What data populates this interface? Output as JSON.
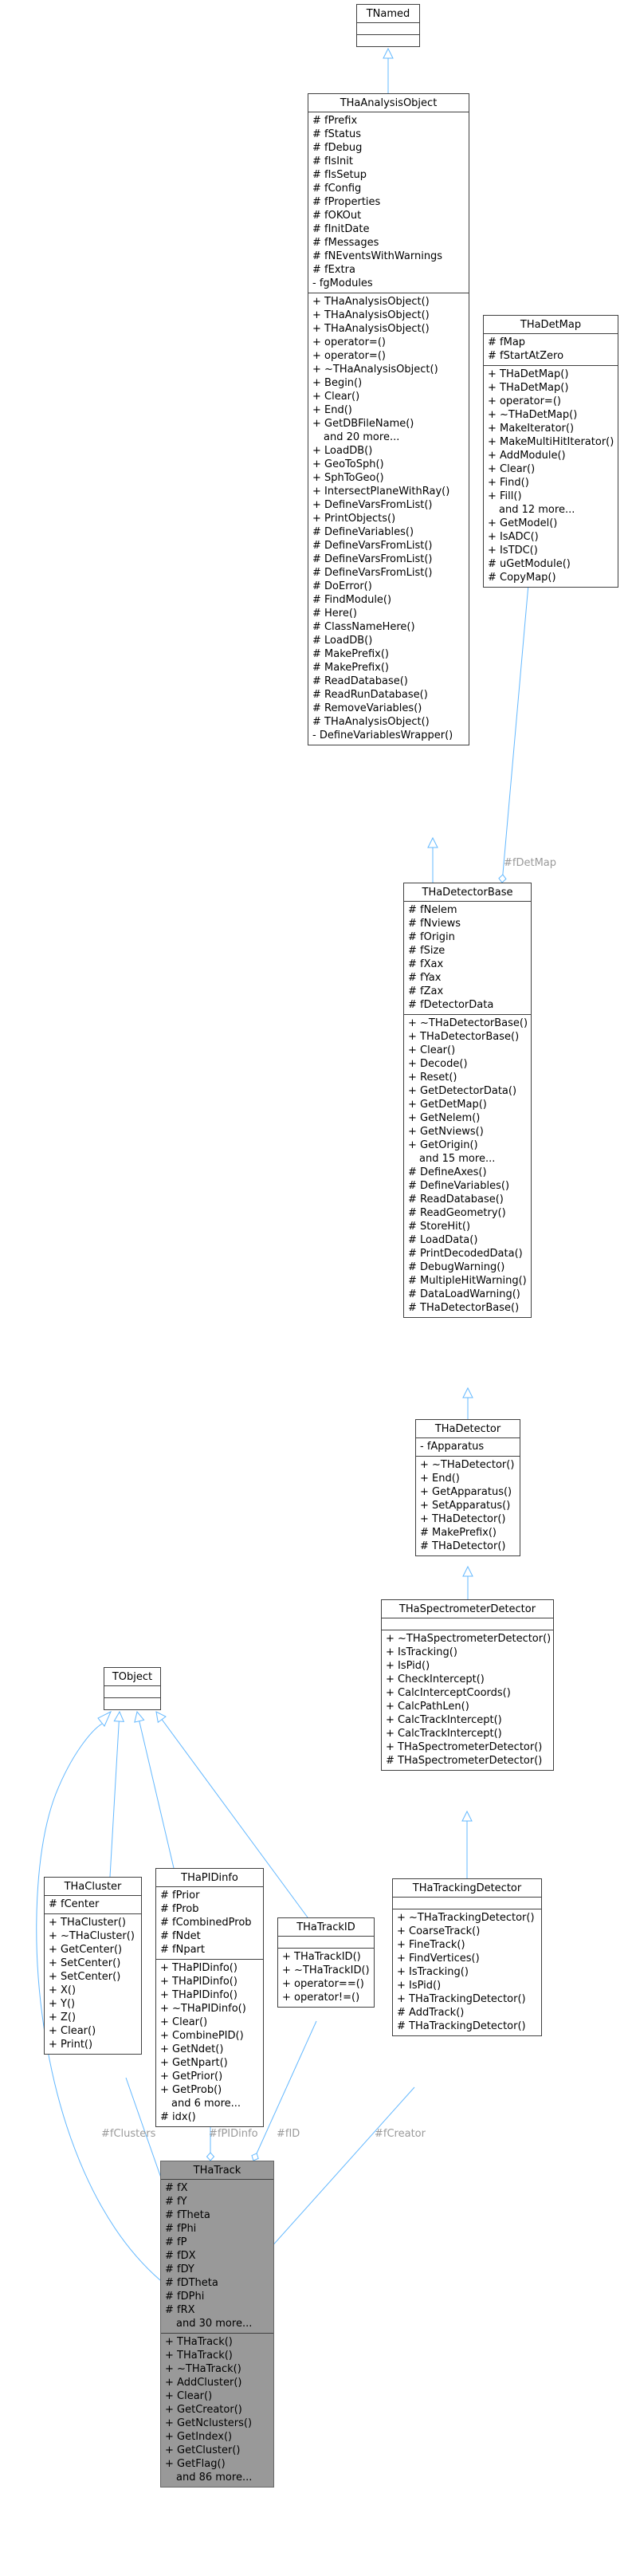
{
  "classes": {
    "TNamed": {
      "name": "TNamed",
      "attrs": [],
      "methods": []
    },
    "THaAnalysisObject": {
      "name": "THaAnalysisObject",
      "attrs": [
        "# fPrefix",
        "# fStatus",
        "# fDebug",
        "# fIsInit",
        "# fIsSetup",
        "# fConfig",
        "# fProperties",
        "# fOKOut",
        "# fInitDate",
        "# fMessages",
        "# fNEventsWithWarnings",
        "# fExtra",
        "- fgModules"
      ],
      "methods": [
        "+ THaAnalysisObject()",
        "+ THaAnalysisObject()",
        "+ THaAnalysisObject()",
        "+ operator=()",
        "+ operator=()",
        "+ ~THaAnalysisObject()",
        "+ Begin()",
        "+ Clear()",
        "+ End()",
        "+ GetDBFileName()",
        "and 20 more...",
        "+ LoadDB()",
        "+ GeoToSph()",
        "+ SphToGeo()",
        "+ IntersectPlaneWithRay()",
        "+ DefineVarsFromList()",
        "+ PrintObjects()",
        "# DefineVariables()",
        "# DefineVarsFromList()",
        "# DefineVarsFromList()",
        "# DefineVarsFromList()",
        "# DoError()",
        "# FindModule()",
        "# Here()",
        "# ClassNameHere()",
        "# LoadDB()",
        "# MakePrefix()",
        "# MakePrefix()",
        "# ReadDatabase()",
        "# ReadRunDatabase()",
        "# RemoveVariables()",
        "# THaAnalysisObject()",
        "- DefineVariablesWrapper()"
      ]
    },
    "THaDetMap": {
      "name": "THaDetMap",
      "attrs": [
        "# fMap",
        "# fStartAtZero"
      ],
      "methods": [
        "+ THaDetMap()",
        "+ THaDetMap()",
        "+ operator=()",
        "+ ~THaDetMap()",
        "+ MakeIterator()",
        "+ MakeMultiHitIterator()",
        "+ AddModule()",
        "+ Clear()",
        "+ Find()",
        "+ Fill()",
        "and 12 more...",
        "+ GetModel()",
        "+ IsADC()",
        "+ IsTDC()",
        "# uGetModule()",
        "# CopyMap()"
      ]
    },
    "THaDetectorBase": {
      "name": "THaDetectorBase",
      "attrs": [
        "# fNelem",
        "# fNviews",
        "# fOrigin",
        "# fSize",
        "# fXax",
        "# fYax",
        "# fZax",
        "# fDetectorData"
      ],
      "methods": [
        "+ ~THaDetectorBase()",
        "+ THaDetectorBase()",
        "+ Clear()",
        "+ Decode()",
        "+ Reset()",
        "+ GetDetectorData()",
        "+ GetDetMap()",
        "+ GetNelem()",
        "+ GetNviews()",
        "+ GetOrigin()",
        "and 15 more...",
        "# DefineAxes()",
        "# DefineVariables()",
        "# ReadDatabase()",
        "# ReadGeometry()",
        "# StoreHit()",
        "# LoadData()",
        "# PrintDecodedData()",
        "# DebugWarning()",
        "# MultipleHitWarning()",
        "# DataLoadWarning()",
        "# THaDetectorBase()"
      ]
    },
    "THaDetector": {
      "name": "THaDetector",
      "attrs": [
        "- fApparatus"
      ],
      "methods": [
        "+ ~THaDetector()",
        "+ End()",
        "+ GetApparatus()",
        "+ SetApparatus()",
        "+ THaDetector()",
        "# MakePrefix()",
        "# THaDetector()"
      ]
    },
    "THaSpectrometerDetector": {
      "name": "THaSpectrometerDetector",
      "attrs": [],
      "methods": [
        "+ ~THaSpectrometerDetector()",
        "+ IsTracking()",
        "+ IsPid()",
        "+ CheckIntercept()",
        "+ CalcInterceptCoords()",
        "+ CalcPathLen()",
        "+ CalcTrackIntercept()",
        "+ CalcTrackIntercept()",
        "+ THaSpectrometerDetector()",
        "# THaSpectrometerDetector()"
      ]
    },
    "TObject": {
      "name": "TObject",
      "attrs": [],
      "methods": []
    },
    "THaCluster": {
      "name": "THaCluster",
      "attrs": [
        "# fCenter"
      ],
      "methods": [
        "+ THaCluster()",
        "+ ~THaCluster()",
        "+ GetCenter()",
        "+ SetCenter()",
        "+ SetCenter()",
        "+ X()",
        "+ Y()",
        "+ Z()",
        "+ Clear()",
        "+ Print()"
      ]
    },
    "THaPIDinfo": {
      "name": "THaPIDinfo",
      "attrs": [
        "# fPrior",
        "# fProb",
        "# fCombinedProb",
        "# fNdet",
        "# fNpart"
      ],
      "methods": [
        "+ THaPIDinfo()",
        "+ THaPIDinfo()",
        "+ THaPIDinfo()",
        "+ ~THaPIDinfo()",
        "+ Clear()",
        "+ CombinePID()",
        "+ GetNdet()",
        "+ GetNpart()",
        "+ GetPrior()",
        "+ GetProb()",
        "and 6 more...",
        "# idx()"
      ]
    },
    "THaTrackID": {
      "name": "THaTrackID",
      "attrs": [],
      "methods": [
        "+ THaTrackID()",
        "+ ~THaTrackID()",
        "+ operator==()",
        "+ operator!=()"
      ]
    },
    "THaTrackingDetector": {
      "name": "THaTrackingDetector",
      "attrs": [],
      "methods": [
        "+ ~THaTrackingDetector()",
        "+ CoarseTrack()",
        "+ FineTrack()",
        "+ FindVertices()",
        "+ IsTracking()",
        "+ IsPid()",
        "+ THaTrackingDetector()",
        "# AddTrack()",
        "# THaTrackingDetector()"
      ]
    },
    "THaTrack": {
      "name": "THaTrack",
      "attrs": [
        "# fX",
        "# fY",
        "# fTheta",
        "# fPhi",
        "# fP",
        "# fDX",
        "# fDY",
        "# fDTheta",
        "# fDPhi",
        "# fRX",
        "and 30 more..."
      ],
      "methods": [
        "+ THaTrack()",
        "+ THaTrack()",
        "+ ~THaTrack()",
        "+ AddCluster()",
        "+ Clear()",
        "+ GetCreator()",
        "+ GetNclusters()",
        "+ GetIndex()",
        "+ GetCluster()",
        "+ GetFlag()",
        "and 86 more..."
      ]
    }
  },
  "relations": {
    "inheritance": [
      [
        "THaAnalysisObject",
        "TNamed"
      ],
      [
        "THaDetectorBase",
        "THaAnalysisObject"
      ],
      [
        "THaDetector",
        "THaDetectorBase"
      ],
      [
        "THaSpectrometerDetector",
        "THaDetector"
      ],
      [
        "THaTrackingDetector",
        "THaSpectrometerDetector"
      ],
      [
        "THaCluster",
        "TObject"
      ],
      [
        "THaPIDinfo",
        "TObject"
      ],
      [
        "THaTrackID",
        "TObject"
      ],
      [
        "THaTrack",
        "TObject"
      ]
    ],
    "usage": [
      {
        "from": "THaDetMap",
        "to": "THaDetectorBase",
        "label": "#fDetMap"
      },
      {
        "from": "THaCluster",
        "to": "THaTrack",
        "label": "#fClusters"
      },
      {
        "from": "THaPIDinfo",
        "to": "THaTrack",
        "label": "#fPIDinfo"
      },
      {
        "from": "THaTrackID",
        "to": "THaTrack",
        "label": "#fID"
      },
      {
        "from": "THaTrackingDetector",
        "to": "THaTrack",
        "label": "#fCreator"
      }
    ]
  },
  "colors": {
    "edge": "#63b8ff",
    "highlight_fill": "#999999",
    "label_text": "#9a9a9a",
    "border": "#404040"
  }
}
